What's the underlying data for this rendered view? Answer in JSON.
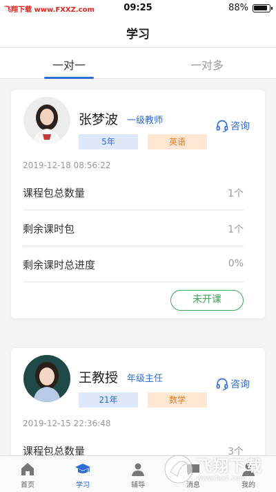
{
  "status_bar": {
    "carrier": "飞翔下载 www.FXXZ.com",
    "time": "09:25",
    "battery": "88%"
  },
  "nav": {
    "title": "学习"
  },
  "tabs": [
    {
      "label": "一对一",
      "active": true
    },
    {
      "label": "一对多",
      "active": false
    }
  ],
  "accent_color": "#2c6cd6",
  "cards": [
    {
      "teacher_name": "张梦波",
      "rank": "一级教师",
      "consult_label": "咨询",
      "grade_tag": "5年",
      "subject_tag": "英语",
      "date": "2019-12-18 08:56:22",
      "rows": [
        {
          "label": "课程包总数量",
          "value": "1个"
        },
        {
          "label": "剩余课时包",
          "value": "1个"
        },
        {
          "label": "剩余课时总进度",
          "value": "0%"
        }
      ],
      "status_button": "未开课"
    },
    {
      "teacher_name": "王教授",
      "rank": "年级主任",
      "consult_label": "咨询",
      "grade_tag": "21年",
      "subject_tag": "数学",
      "date": "2019-12-15 22:36:48",
      "rows": [
        {
          "label": "课程包总数量",
          "value": "3个"
        }
      ]
    }
  ],
  "tabbar": [
    {
      "label": "首页",
      "icon": "home-icon"
    },
    {
      "label": "学习",
      "icon": "graduation-cap-icon",
      "active": true
    },
    {
      "label": "辅导",
      "icon": "tutor-icon"
    },
    {
      "label": "消息",
      "icon": "message-icon"
    },
    {
      "label": "我的",
      "icon": "profile-icon"
    }
  ],
  "watermark": {
    "text": "飞翔下载",
    "url": "www.fxxz.com"
  }
}
